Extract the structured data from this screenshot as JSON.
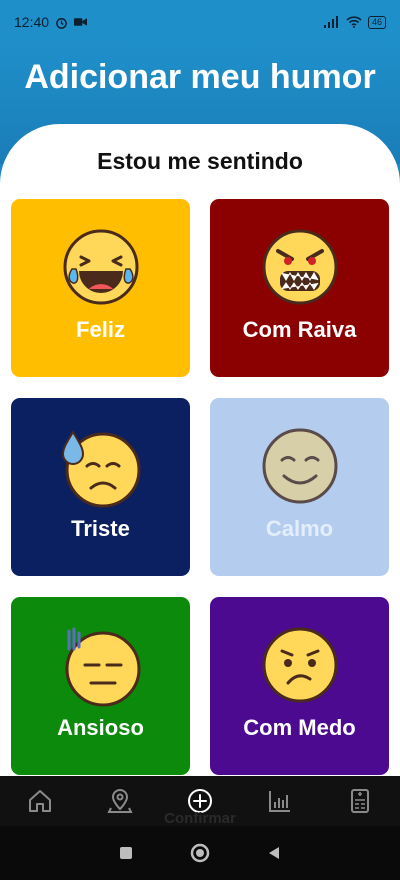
{
  "status_bar": {
    "time": "12:40",
    "battery": "46"
  },
  "header": {
    "title": "Adicionar meu humor"
  },
  "main": {
    "subtitle": "Estou me sentindo",
    "moods": [
      {
        "label": "Feliz",
        "icon": "laughing-tears-emoji-icon",
        "color": "#ffbf00"
      },
      {
        "label": "Com Raiva",
        "icon": "angry-face-emoji-icon",
        "color": "#8b0000"
      },
      {
        "label": "Triste",
        "icon": "sad-sweat-emoji-icon",
        "color": "#0b2060"
      },
      {
        "label": "Calmo",
        "icon": "smiling-face-emoji-icon",
        "color": "#b4cdef"
      },
      {
        "label": "Ansioso",
        "icon": "anxious-face-emoji-icon",
        "color": "#0b8a0b"
      },
      {
        "label": "Com Medo",
        "icon": "worried-face-emoji-icon",
        "color": "#4b0a8f"
      }
    ]
  },
  "bottom_nav": {
    "items": [
      "home-icon",
      "map-pin-icon",
      "add-circle-icon",
      "chart-icon",
      "calculator-icon"
    ],
    "confirm_label": "Confirmar"
  }
}
